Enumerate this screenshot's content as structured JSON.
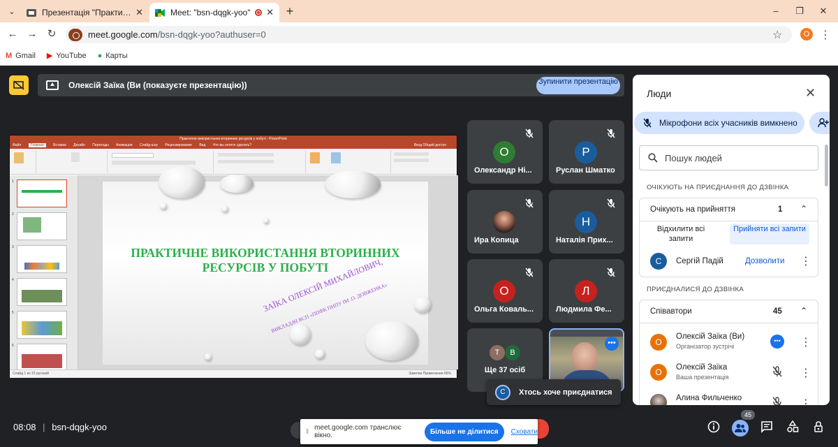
{
  "browser": {
    "tabs": [
      {
        "title": "Презентація \"Практичне викорис"
      },
      {
        "title": "Meet: \"bsn-dqgk-yoo\""
      }
    ],
    "url_host": "meet.google.com",
    "url_rest": "/bsn-dqgk-yoo?authuser=0",
    "profile_initial": "О",
    "bookmarks": [
      {
        "label": "Gmail",
        "icon": "gmail-icon"
      },
      {
        "label": "YouTube",
        "icon": "youtube-icon"
      },
      {
        "label": "Карты",
        "icon": "maps-icon"
      }
    ]
  },
  "meet": {
    "presenting_label": "Олексій Заїка (Ви (показуєте презентацію))",
    "stop_presenting_label": "Зупинити презентацію",
    "shared_screen": {
      "window_title": "Практичне використання вторинних ресурсів у побуті - PowerPoint",
      "menu": [
        "Файл",
        "Главная",
        "Вставка",
        "Дизайн",
        "Переходы",
        "Анимация",
        "Слайд-шоу",
        "Рецензирование",
        "Вид",
        "Что вы хотите сделать?"
      ],
      "menu_right": "Вход  Общий доступ",
      "thumbnail_numbers": [
        "1",
        "2",
        "3",
        "4",
        "5",
        "6"
      ],
      "status_left": "Слайд 1 из 15    русский",
      "status_right": "Заметки   Примечания        66%",
      "slide_title": "ПРАКТИЧНЕ ВИКОРИСТАННЯ ВТОРИННИХ РЕСУРСІВ У ПОБУТІ",
      "slide_author": "ЗАЇКА ОЛЕКСІЙ МИХАЙЛОВИЧ,",
      "slide_author_sub": "ВИКЛАДАЧ ВСП «ППФК ПНПУ ІМ .О. ДОВЖЕНКА»"
    },
    "tiles": [
      {
        "initial": "О",
        "name": "Олександр Ні...",
        "color": "#2e7d32"
      },
      {
        "initial": "Р",
        "name": "Руслан Шматко",
        "color": "#1a5d9c"
      },
      {
        "initial": "",
        "name": "Ира Копица",
        "color": "#6b4e3d"
      },
      {
        "initial": "Н",
        "name": "Наталія Прих...",
        "color": "#1a5d9c"
      },
      {
        "initial": "О",
        "name": "Ольга Коваль...",
        "color": "#c5221f"
      },
      {
        "initial": "Л",
        "name": "Людмила Фе...",
        "color": "#c5221f"
      }
    ],
    "more_tile": {
      "label": "Ще 37 осіб",
      "avatars": [
        "Т",
        "В"
      ]
    },
    "join_toast": {
      "initial": "С",
      "text": "Хтось хоче приєднатися"
    },
    "time": "08:08",
    "meeting_code": "bsn-dqgk-yoo",
    "share_banner": {
      "text": "meet.google.com транслює вікно.",
      "stop_label": "Більше не ділитися",
      "hide_label": "Сховати"
    },
    "participant_count": "45"
  },
  "people": {
    "title": "Люди",
    "mute_all_label": "Мікрофони всіх учасників вимкнено",
    "search_placeholder": "Пошук людей",
    "waiting_section": "ОЧІКУЮТЬ НА ПРИЄДНАННЯ ДО ДЗВІНКА",
    "waiting_header": "Очікують на прийняття",
    "waiting_count": "1",
    "deny_all": "Відхилити всі запити",
    "accept_all": "Прийняти всі запити",
    "waiting_person": {
      "initial": "С",
      "name": "Сергій Падій",
      "action": "Дозволити"
    },
    "joined_section": "ПРИЄДНАЛИСЯ ДО ДЗВІНКА",
    "cohosts_header": "Співавтори",
    "cohosts_count": "45",
    "participants": [
      {
        "initial": "О",
        "name": "Олексій Заїка (Ви)",
        "sub": "Організатор зустрічі"
      },
      {
        "initial": "О",
        "name": "Олексій Заїка",
        "sub": "Ваша презентація"
      },
      {
        "initial": "",
        "name": "Алина Фильченко",
        "sub": ""
      }
    ]
  }
}
